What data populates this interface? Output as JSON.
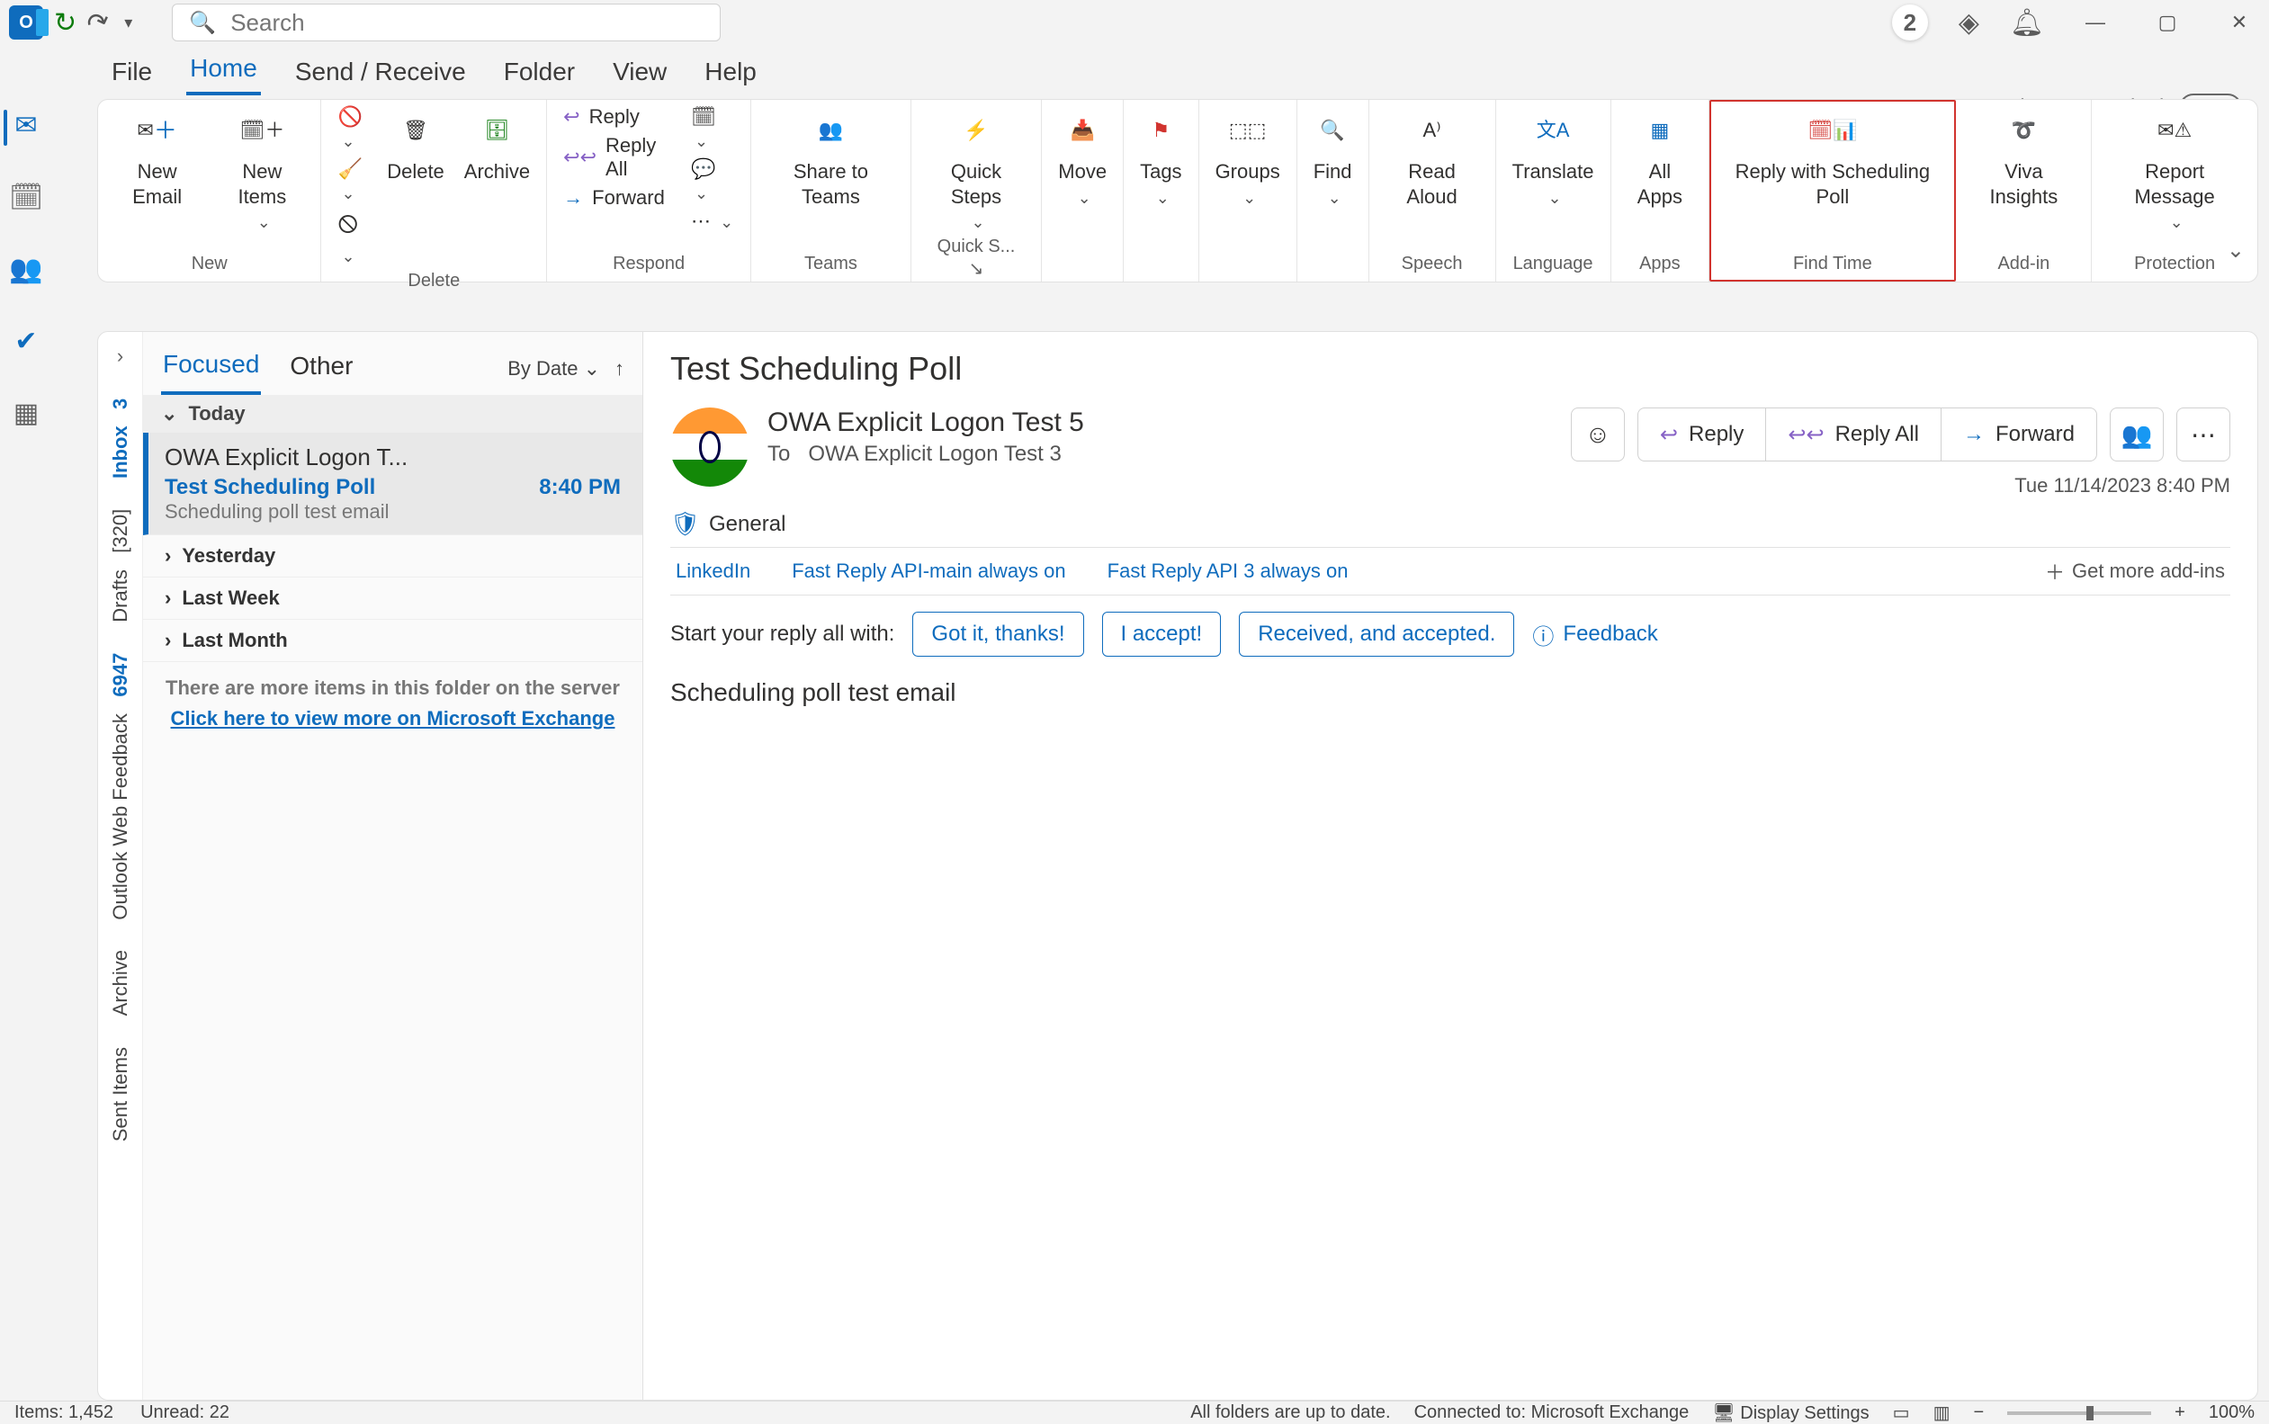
{
  "titlebar": {
    "search_placeholder": "Search",
    "notif_badge": "2"
  },
  "new_outlook": {
    "label": "Try the new Outlook",
    "toggle": "Off"
  },
  "tabs": [
    "File",
    "Home",
    "Send / Receive",
    "Folder",
    "View",
    "Help"
  ],
  "active_tab": "Home",
  "ribbon": {
    "new": {
      "label": "New",
      "new_email": "New Email",
      "new_items": "New Items"
    },
    "delete": {
      "label": "Delete",
      "delete": "Delete",
      "archive": "Archive"
    },
    "respond": {
      "label": "Respond",
      "reply": "Reply",
      "reply_all": "Reply All",
      "forward": "Forward"
    },
    "teams": {
      "label": "Teams",
      "share": "Share to Teams"
    },
    "quick": {
      "label": "Quick S...",
      "steps": "Quick Steps"
    },
    "move": {
      "label": "Move"
    },
    "tags": {
      "label": "Tags"
    },
    "groups": {
      "label": "Groups"
    },
    "find": {
      "label": "Find"
    },
    "speech": {
      "label": "Speech",
      "read": "Read Aloud"
    },
    "language": {
      "label": "Language",
      "translate": "Translate"
    },
    "apps": {
      "label": "Apps",
      "all": "All Apps"
    },
    "findtime": {
      "label": "Find Time",
      "poll": "Reply with Scheduling Poll"
    },
    "addin": {
      "label": "Add-in",
      "viva": "Viva Insights"
    },
    "protection": {
      "label": "Protection",
      "report": "Report Message"
    }
  },
  "folders": {
    "inbox": {
      "name": "Inbox",
      "count": "3"
    },
    "drafts": {
      "name": "Drafts",
      "count": "[320]"
    },
    "owf": {
      "name": "Outlook Web Feedback",
      "count": "6947"
    },
    "archive": {
      "name": "Archive"
    },
    "sent": {
      "name": "Sent Items"
    }
  },
  "list": {
    "tab_focused": "Focused",
    "tab_other": "Other",
    "sort": "By Date",
    "group_today": "Today",
    "group_yesterday": "Yesterday",
    "group_lastweek": "Last Week",
    "group_lastmonth": "Last Month",
    "more_text": "There are more items in this folder on the server",
    "more_link": "Click here to view more on Microsoft Exchange",
    "msg": {
      "from": "OWA Explicit Logon T...",
      "subject": "Test Scheduling Poll",
      "time": "8:40 PM",
      "preview": "Scheduling poll test email"
    }
  },
  "reading": {
    "title": "Test Scheduling Poll",
    "sender": "OWA Explicit Logon Test 5",
    "to_label": "To",
    "to": "OWA Explicit Logon Test 3",
    "date": "Tue 11/14/2023 8:40 PM",
    "general": "General",
    "actions": {
      "reply": "Reply",
      "reply_all": "Reply All",
      "forward": "Forward"
    },
    "addins": {
      "linkedin": "LinkedIn",
      "fr1": "Fast Reply API-main always on",
      "fr2": "Fast Reply API 3 always on",
      "more": "Get more add-ins"
    },
    "quick_label": "Start your reply all with:",
    "quick": [
      "Got it, thanks!",
      "I accept!",
      "Received, and accepted."
    ],
    "feedback": "Feedback",
    "body": "Scheduling poll test email"
  },
  "status": {
    "items": "Items: 1,452",
    "unread": "Unread: 22",
    "sync": "All folders are up to date.",
    "conn": "Connected to: Microsoft Exchange",
    "disp": "Display Settings",
    "zoom": "100%"
  }
}
